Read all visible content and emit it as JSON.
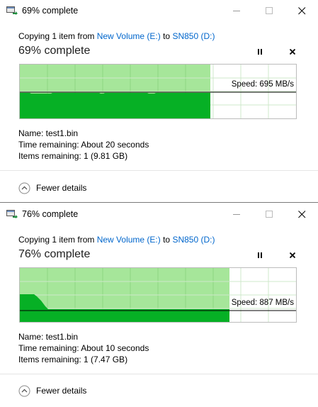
{
  "dialogs": [
    {
      "window_title": "69% complete",
      "copy_prefix": "Copying 1 item from",
      "source": "New Volume (E:)",
      "to_word": "to",
      "destination": "SN850 (D:)",
      "progress_title": "69% complete",
      "progress": 0.69,
      "speed": "Speed: 695 MB/s",
      "name_line": "Name:  test1.bin",
      "time_line": "Time remaining:  About 20 seconds",
      "items_line": "Items remaining:  1 (9.81 GB)",
      "details_label": "Fewer details"
    },
    {
      "window_title": "76% complete",
      "copy_prefix": "Copying 1 item from",
      "source": "New Volume (E:)",
      "to_word": "to",
      "destination": "SN850 (D:)",
      "progress_title": "76% complete",
      "progress": 0.76,
      "speed": "Speed: 887 MB/s",
      "name_line": "Name:  test1.bin",
      "time_line": "Time remaining:  About 10 seconds",
      "items_line": "Items remaining:  1 (7.47 GB)",
      "details_label": "Fewer details"
    }
  ],
  "colors": {
    "graph_light_green": "#a6e69a",
    "graph_green": "#06b025",
    "grid": "#cfe8cb",
    "link": "#0066cc"
  },
  "icons": [
    "copy-window-icon",
    "minimize-icon",
    "maximize-icon",
    "close-icon",
    "pause-icon",
    "stop-icon",
    "chevron-up-circle-icon"
  ]
}
